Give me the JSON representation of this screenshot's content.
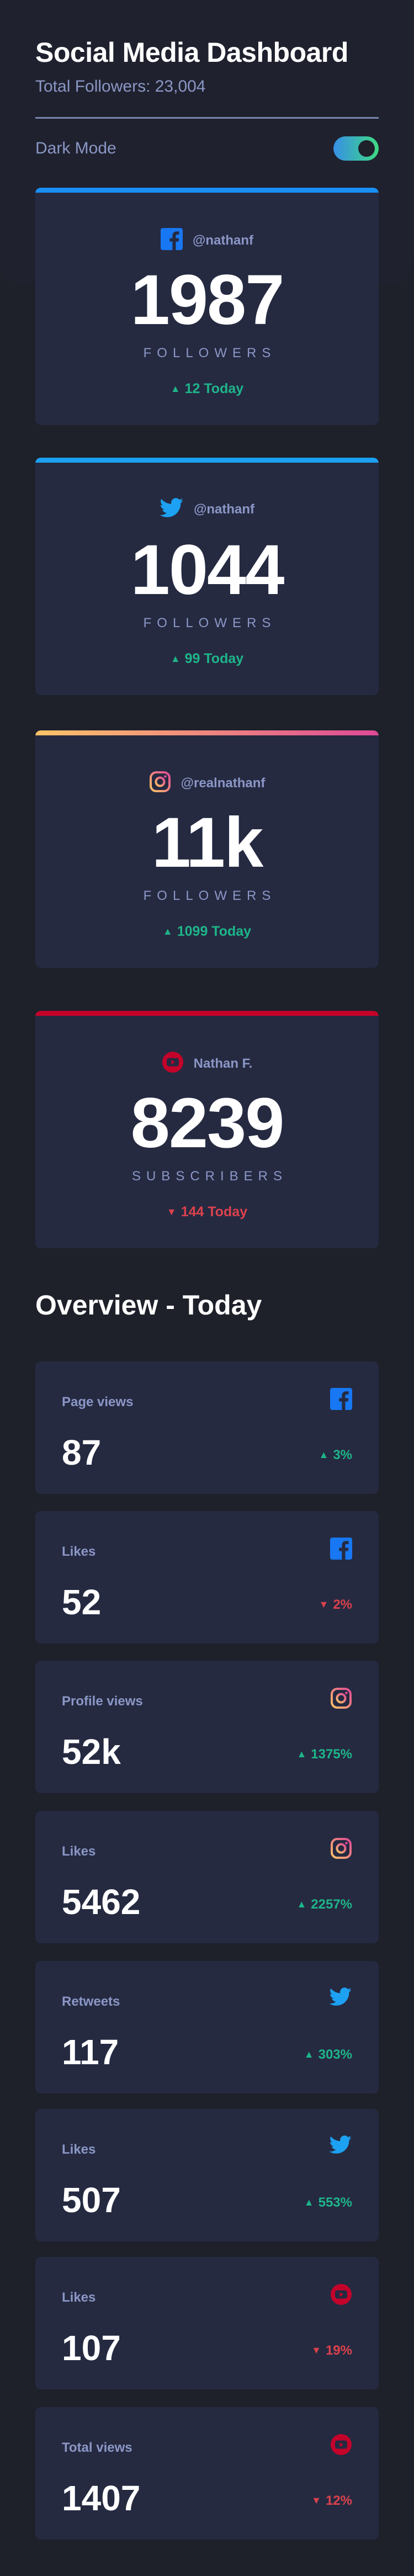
{
  "header": {
    "title": "Social Media Dashboard",
    "total_followers": "Total Followers: 23,004"
  },
  "mode": {
    "label": "Dark Mode",
    "enabled": true
  },
  "followers_cards": [
    {
      "platform": "facebook",
      "icon": "facebook-icon",
      "handle": "@nathanf",
      "count": "1987",
      "unit": "FOLLOWERS",
      "change": "12 Today",
      "direction": "up",
      "accent": "#198ff5"
    },
    {
      "platform": "twitter",
      "icon": "twitter-icon",
      "handle": "@nathanf",
      "count": "1044",
      "unit": "FOLLOWERS",
      "change": "99 Today",
      "direction": "up",
      "accent": "#1ca0f2"
    },
    {
      "platform": "instagram",
      "icon": "instagram-icon",
      "handle": "@realnathanf",
      "count": "11k",
      "unit": "FOLLOWERS",
      "change": "1099 Today",
      "direction": "up",
      "accent": "#fdc468 → #df4996"
    },
    {
      "platform": "youtube",
      "icon": "youtube-icon",
      "handle": "Nathan F.",
      "count": "8239",
      "unit": "SUBSCRIBERS",
      "change": "144 Today",
      "direction": "down",
      "accent": "#c4032a"
    }
  ],
  "overview": {
    "title": "Overview - Today",
    "cards": [
      {
        "label": "Page views",
        "icon": "facebook-icon",
        "value": "87",
        "change": "3%",
        "direction": "up"
      },
      {
        "label": "Likes",
        "icon": "facebook-icon",
        "value": "52",
        "change": "2%",
        "direction": "down"
      },
      {
        "label": "Profile views",
        "icon": "instagram-icon",
        "value": "52k",
        "change": "1375%",
        "direction": "up"
      },
      {
        "label": "Likes",
        "icon": "instagram-icon",
        "value": "5462",
        "change": "2257%",
        "direction": "up"
      },
      {
        "label": "Retweets",
        "icon": "twitter-icon",
        "value": "117",
        "change": "303%",
        "direction": "up"
      },
      {
        "label": "Likes",
        "icon": "twitter-icon",
        "value": "507",
        "change": "553%",
        "direction": "up"
      },
      {
        "label": "Likes",
        "icon": "youtube-icon",
        "value": "107",
        "change": "19%",
        "direction": "down"
      },
      {
        "label": "Total views",
        "icon": "youtube-icon",
        "value": "1407",
        "change": "12%",
        "direction": "down"
      }
    ]
  },
  "colors": {
    "background": "#1e202a",
    "card": "#252a41",
    "text_muted": "#8b97c6",
    "up": "#1eb589",
    "down": "#dc414c"
  }
}
